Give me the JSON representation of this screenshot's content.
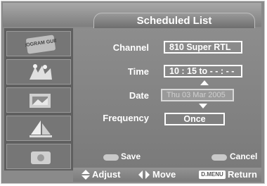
{
  "header": {
    "title": "Scheduled List"
  },
  "sidebar": {
    "items": [
      {
        "icon": "program-guide-icon",
        "label": "PROGRAM GUIDE"
      },
      {
        "icon": "dancers-icon"
      },
      {
        "icon": "photo-frame-icon"
      },
      {
        "icon": "sailboat-icon"
      },
      {
        "icon": "screen-icon"
      }
    ]
  },
  "form": {
    "channel": {
      "label": "Channel",
      "value": "810 Super RTL"
    },
    "time": {
      "label": "Time",
      "value": "10 : 15 to - - : - -"
    },
    "date": {
      "label": "Date",
      "value": "Thu 03 Mar 2005"
    },
    "frequency": {
      "label": "Frequency",
      "value": "Once"
    }
  },
  "actions": {
    "save": "Save",
    "cancel": "Cancel"
  },
  "footer": {
    "adjust": "Adjust",
    "move": "Move",
    "menu_key": "D.MENU",
    "return": "Return"
  },
  "colors": {
    "background": "#8a8a8a",
    "text": "#ffffff",
    "accent_pill": "#c9c9c9"
  }
}
